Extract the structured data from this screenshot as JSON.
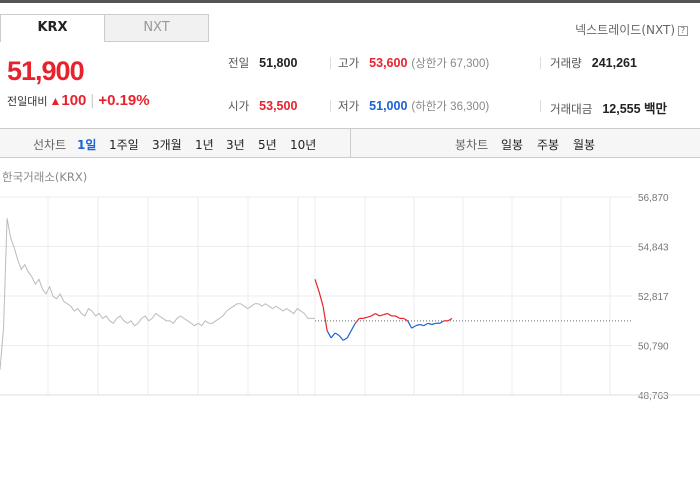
{
  "tabs": [
    {
      "label": "KRX",
      "selected": true
    },
    {
      "label": "NXT",
      "selected": false
    }
  ],
  "nxt_link": "넥스트레이드(NXT)",
  "price": {
    "current": "51,900",
    "change_label": "전일대비",
    "change_abs": "100",
    "change_pct": "+0.19%",
    "direction": "up"
  },
  "stats": {
    "prev_close": {
      "label": "전일",
      "value": "51,800"
    },
    "high": {
      "label": "고가",
      "value": "53,600",
      "sub": "(상한가 67,300)"
    },
    "volume": {
      "label": "거래량",
      "value": "241,261"
    },
    "open": {
      "label": "시가",
      "value": "53,500"
    },
    "low": {
      "label": "저가",
      "value": "51,000",
      "sub": "(하한가 36,300)"
    },
    "amount": {
      "label": "거래대금",
      "value": "12,555 백만"
    }
  },
  "toolbar": {
    "line_chart_label": "선차트",
    "periods": [
      "1일",
      "1주일",
      "3개월",
      "1년",
      "3년",
      "5년",
      "10년"
    ],
    "selected_period": "1일",
    "candle_chart_label": "봉차트",
    "candle_periods": [
      "일봉",
      "주봉",
      "월봉"
    ]
  },
  "chart_label": "한국거래소(KRX)",
  "colors": {
    "up": "#e8222d",
    "down": "#1b62d4",
    "history": "#bbbbbb"
  },
  "chart_data": {
    "type": "line",
    "yticks": [
      "56,870",
      "54,843",
      "52,817",
      "50,790",
      "48,763"
    ],
    "ylim": [
      48763,
      56870
    ],
    "reference_price": 51800,
    "grid": true,
    "series": [
      {
        "role": "previous-day",
        "values": [
          49800,
          51500,
          56000,
          55200,
          54800,
          54300,
          53900,
          54100,
          53800,
          53600,
          53300,
          53500,
          53100,
          52900,
          53200,
          52800,
          52700,
          52900,
          52600,
          52500,
          52400,
          52200,
          52300,
          52100,
          52000,
          52300,
          52200,
          52000,
          52100,
          51900,
          52000,
          51800,
          51700,
          51900,
          52000,
          51800,
          51700,
          51800,
          51600,
          51700,
          51900,
          52000,
          51800,
          51900,
          52100,
          52000,
          51900,
          51800,
          51800,
          51700,
          51900,
          52000,
          51900,
          51800,
          51700,
          51600,
          51700,
          51600,
          51800,
          51700,
          51700,
          51800,
          51900,
          52000,
          52200,
          52300,
          52400,
          52500,
          52500,
          52400,
          52300,
          52400,
          52500,
          52500,
          52400,
          52500,
          52400,
          52300,
          52400,
          52300,
          52200,
          52300,
          52200,
          52100,
          52300,
          52200,
          52100,
          51900,
          51900,
          51900
        ]
      },
      {
        "role": "today",
        "values": [
          53500,
          53000,
          52400,
          51400,
          51100,
          51300,
          51200,
          51000,
          51100,
          51400,
          51700,
          51900,
          51900,
          51950,
          52000,
          52100,
          52000,
          52050,
          52100,
          52000,
          52000,
          51900,
          51900,
          51800,
          51500,
          51600,
          51650,
          51600,
          51700,
          51650,
          51700,
          51700,
          51800,
          51800,
          51900
        ]
      }
    ]
  }
}
